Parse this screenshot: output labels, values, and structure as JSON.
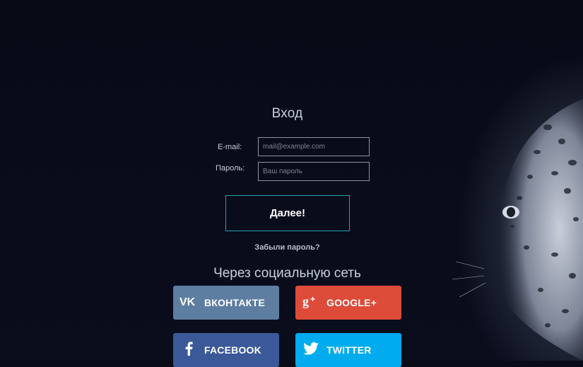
{
  "login": {
    "title": "Вход",
    "email_label": "E-mail:",
    "email_placeholder": "mail@example.com",
    "password_label": "Пароль:",
    "password_placeholder": "Ваш пароль",
    "submit_label": "Далее!",
    "forgot_link": "Забыли пароль?"
  },
  "social": {
    "title": "Через социальную сеть",
    "buttons": [
      {
        "label": "ВКОНТАКТЕ",
        "icon": "vk-icon",
        "color": "#5d7ea1"
      },
      {
        "label": "GOOGLE+",
        "icon": "google-plus-icon",
        "color": "#dd4b39"
      },
      {
        "label": "FACEBOOK",
        "icon": "facebook-icon",
        "color": "#3b5998"
      },
      {
        "label": "TWITTER",
        "icon": "twitter-icon",
        "color": "#00aced"
      }
    ]
  },
  "colors": {
    "background": "#090b18",
    "button_border": "#2a9fb6"
  },
  "decor": {
    "background_image": "leopard"
  }
}
